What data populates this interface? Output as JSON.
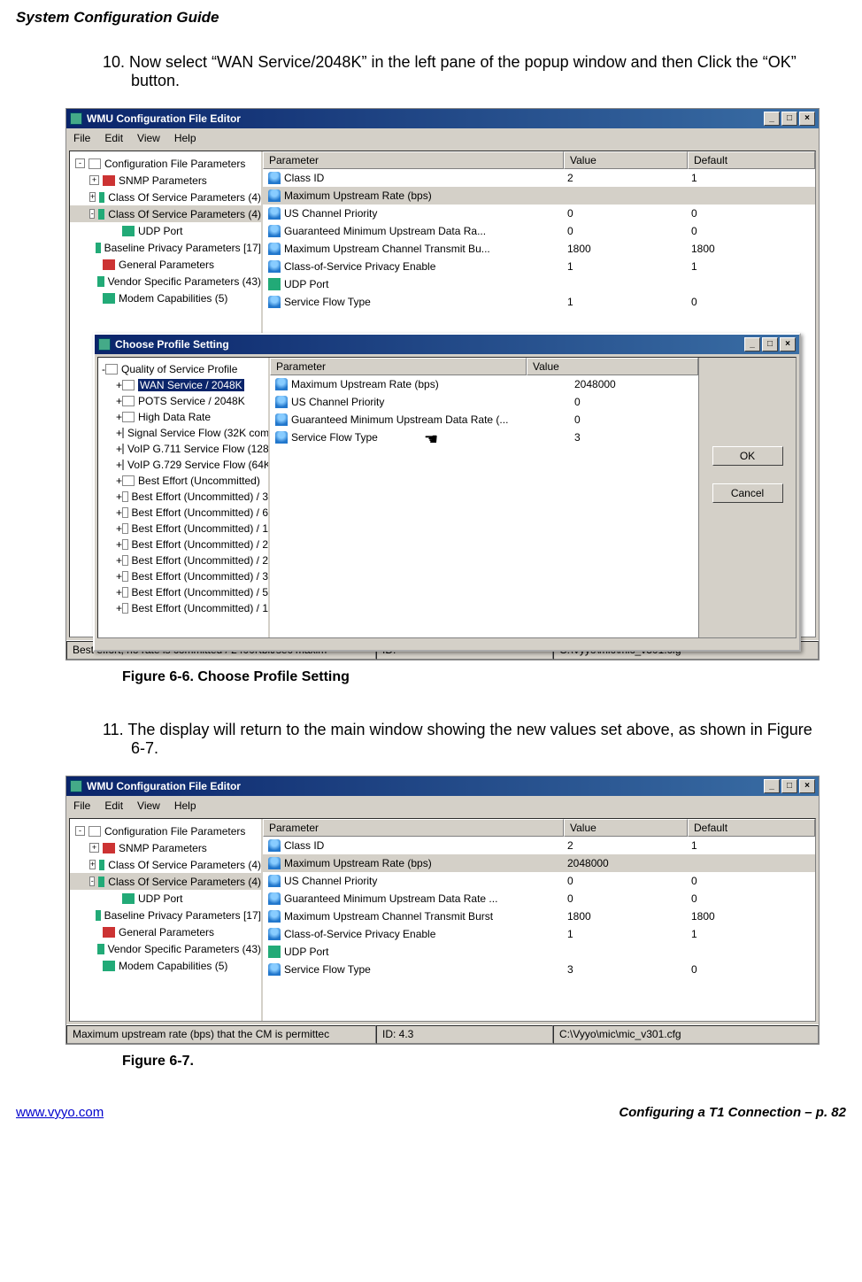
{
  "doc_header": "System Configuration Guide",
  "step10": "10. Now select “WAN Service/2048K” in the left pane of the popup window and then Click the “OK” button.",
  "step11": "11. The display will return to the main window showing the new values set above, as shown in Figure 6-7.",
  "fig1_caption": "Figure 6-6. Choose Profile Setting",
  "fig2_caption": "Figure 6-7.",
  "footer_url": "www.vyyo.com",
  "footer_right": "Configuring a T1 Connection – p. 82",
  "win": {
    "title": "WMU Configuration File Editor",
    "menu": [
      "File",
      "Edit",
      "View",
      "Help"
    ]
  },
  "tree_main": [
    {
      "lvl": 0,
      "exp": "-",
      "icon": "doc",
      "label": "Configuration File Parameters"
    },
    {
      "lvl": 1,
      "exp": "+",
      "icon": "red",
      "label": "SNMP Parameters"
    },
    {
      "lvl": 1,
      "exp": "+",
      "icon": "green",
      "label": "Class Of Service Parameters (4)"
    },
    {
      "lvl": 1,
      "exp": "-",
      "icon": "green",
      "label": "Class Of Service Parameters (4)",
      "sel": true
    },
    {
      "lvl": 2,
      "exp": "",
      "icon": "green",
      "label": "UDP Port"
    },
    {
      "lvl": 1,
      "exp": "",
      "icon": "green",
      "label": "Baseline Privacy Parameters [17]"
    },
    {
      "lvl": 1,
      "exp": "",
      "icon": "red",
      "label": "General Parameters"
    },
    {
      "lvl": 1,
      "exp": "",
      "icon": "green",
      "label": "Vendor Specific Parameters (43)"
    },
    {
      "lvl": 1,
      "exp": "",
      "icon": "green",
      "label": "Modem Capabilities (5)"
    }
  ],
  "list_head": [
    "Parameter",
    "Value",
    "Default"
  ],
  "list_rows1": [
    {
      "icon": "leaf",
      "p": "Class ID",
      "v": "2",
      "d": "1"
    },
    {
      "icon": "leaf",
      "p": "Maximum Upstream Rate (bps)",
      "v": "",
      "d": "",
      "sel": true
    },
    {
      "icon": "leaf",
      "p": "US Channel Priority",
      "v": "0",
      "d": "0"
    },
    {
      "icon": "leaf",
      "p": "Guaranteed Minimum Upstream Data Ra...",
      "v": "0",
      "d": "0"
    },
    {
      "icon": "leaf",
      "p": "Maximum Upstream Channel Transmit Bu...",
      "v": "1800",
      "d": "1800"
    },
    {
      "icon": "leaf",
      "p": "Class-of-Service Privacy Enable",
      "v": "1",
      "d": "1"
    },
    {
      "icon": "port",
      "p": "UDP Port",
      "v": "",
      "d": ""
    },
    {
      "icon": "leaf",
      "p": "Service Flow Type",
      "v": "1",
      "d": "0"
    }
  ],
  "list_rows2": [
    {
      "icon": "leaf",
      "p": "Class ID",
      "v": "2",
      "d": "1"
    },
    {
      "icon": "leaf",
      "p": "Maximum Upstream Rate (bps)",
      "v": "2048000",
      "d": "",
      "sel": true
    },
    {
      "icon": "leaf",
      "p": "US Channel Priority",
      "v": "0",
      "d": "0"
    },
    {
      "icon": "leaf",
      "p": "Guaranteed Minimum Upstream Data Rate ...",
      "v": "0",
      "d": "0"
    },
    {
      "icon": "leaf",
      "p": "Maximum Upstream Channel Transmit Burst",
      "v": "1800",
      "d": "1800"
    },
    {
      "icon": "leaf",
      "p": "Class-of-Service Privacy Enable",
      "v": "1",
      "d": "1"
    },
    {
      "icon": "port",
      "p": "UDP Port",
      "v": "",
      "d": ""
    },
    {
      "icon": "leaf",
      "p": "Service Flow Type",
      "v": "3",
      "d": "0"
    }
  ],
  "popup": {
    "title": "Choose Profile Setting",
    "tree": [
      {
        "lvl": 0,
        "exp": "-",
        "label": "Quality of Service Profile"
      },
      {
        "lvl": 1,
        "exp": "+",
        "label": "WAN Service / 2048K",
        "sel": true
      },
      {
        "lvl": 1,
        "exp": "+",
        "label": "POTS Service / 2048K"
      },
      {
        "lvl": 1,
        "exp": "+",
        "label": "High Data Rate"
      },
      {
        "lvl": 1,
        "exp": "+",
        "label": "Signal Service Flow (32K comr"
      },
      {
        "lvl": 1,
        "exp": "+",
        "label": "VoIP G.711 Service Flow (128"
      },
      {
        "lvl": 1,
        "exp": "+",
        "label": "VoIP G.729 Service Flow (64K"
      },
      {
        "lvl": 1,
        "exp": "+",
        "label": "Best Effort (Uncommitted)"
      },
      {
        "lvl": 1,
        "exp": "+",
        "label": "Best Effort (Uncommitted) / 3"
      },
      {
        "lvl": 1,
        "exp": "+",
        "label": "Best Effort (Uncommitted) / 6"
      },
      {
        "lvl": 1,
        "exp": "+",
        "label": "Best Effort (Uncommitted) / 1"
      },
      {
        "lvl": 1,
        "exp": "+",
        "label": "Best Effort (Uncommitted) / 2"
      },
      {
        "lvl": 1,
        "exp": "+",
        "label": "Best Effort (Uncommitted) / 2"
      },
      {
        "lvl": 1,
        "exp": "+",
        "label": "Best Effort (Uncommitted) / 3"
      },
      {
        "lvl": 1,
        "exp": "+",
        "label": "Best Effort (Uncommitted) / 5"
      },
      {
        "lvl": 1,
        "exp": "+",
        "label": "Best Effort (Uncommitted) / 1"
      }
    ],
    "list_head": [
      "Parameter",
      "Value"
    ],
    "list_rows": [
      {
        "icon": "leaf",
        "p": "Maximum Upstream Rate (bps)",
        "v": "2048000"
      },
      {
        "icon": "leaf",
        "p": "US Channel Priority",
        "v": "0"
      },
      {
        "icon": "leaf",
        "p": "Guaranteed Minimum Upstream Data Rate (...",
        "v": "0"
      },
      {
        "icon": "leaf",
        "p": "Service Flow Type",
        "v": "3",
        "link": true
      }
    ],
    "ok": "OK",
    "cancel": "Cancel"
  },
  "status1": {
    "left": "Best effort, no rate is committed / 2400Kbit/sec maxim",
    "mid": "ID:",
    "right": "C:\\Vyyo\\mic\\mic_v301.cfg"
  },
  "status2": {
    "left": "Maximum upstream rate (bps) that the CM is permittec",
    "mid": "ID: 4.3",
    "right": "C:\\Vyyo\\mic\\mic_v301.cfg"
  }
}
